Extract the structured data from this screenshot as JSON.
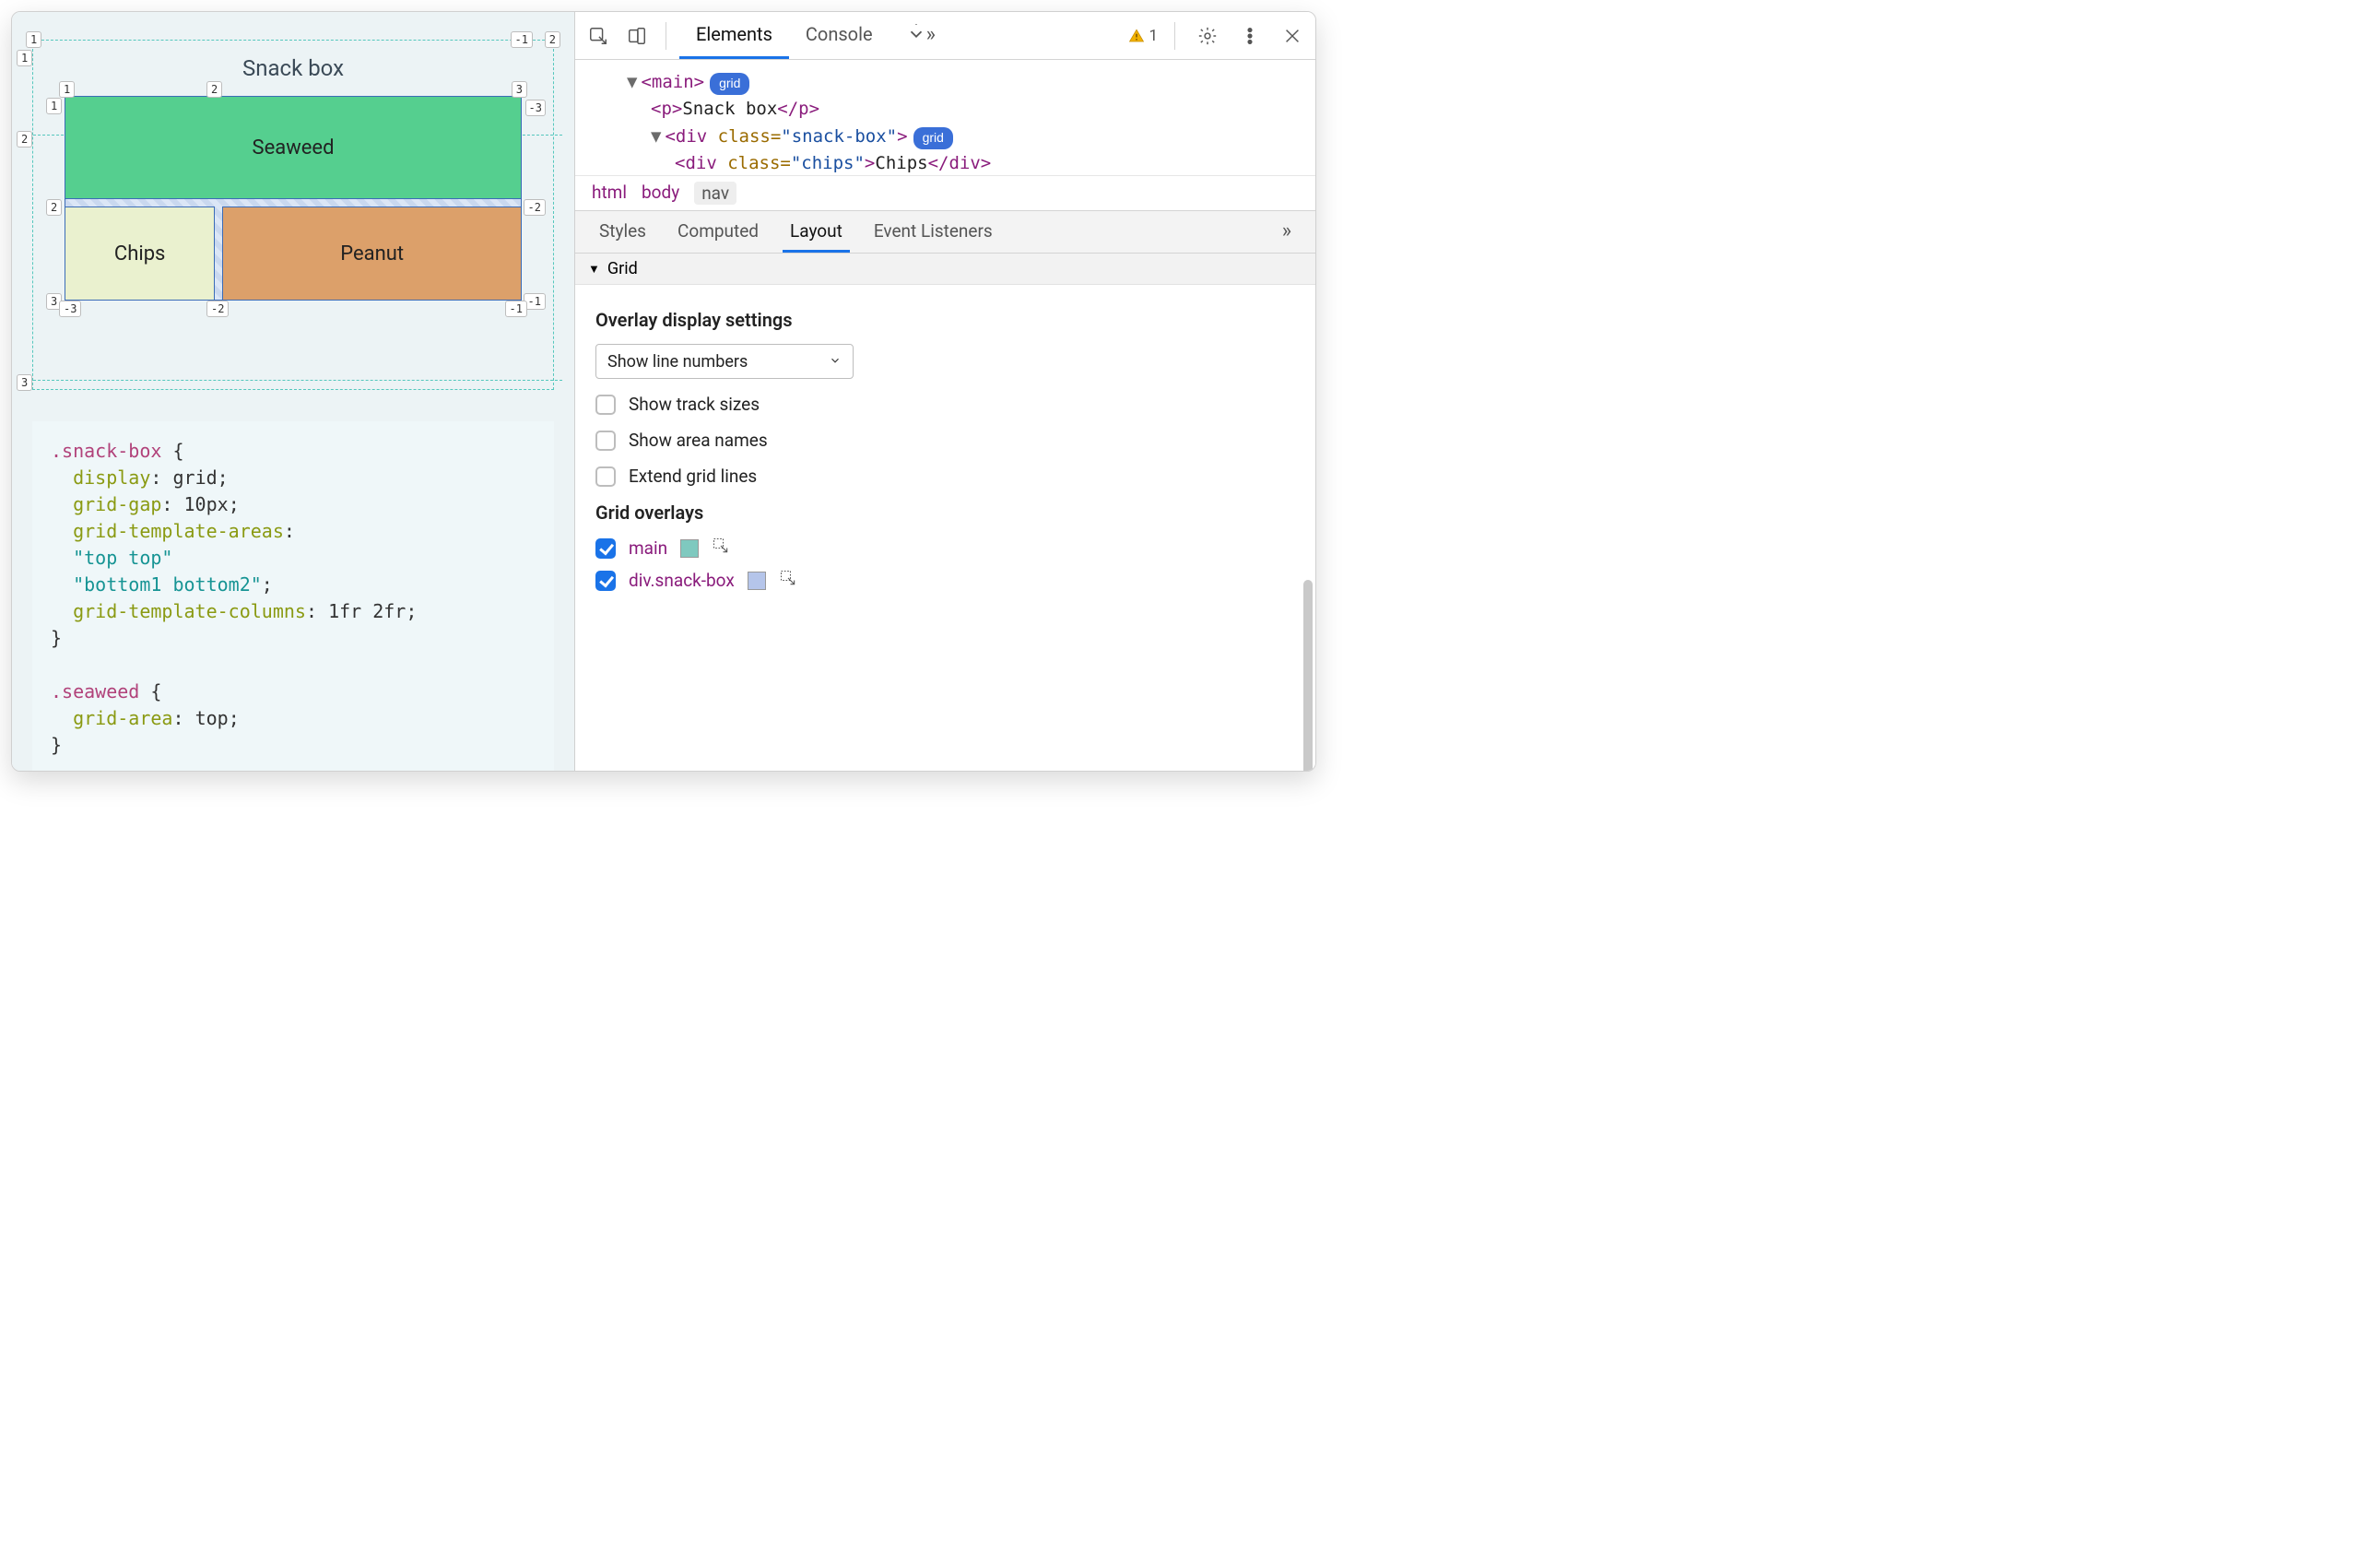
{
  "page": {
    "title": "Snack box",
    "cells": {
      "seaweed": "Seaweed",
      "chips": "Chips",
      "peanut": "Peanut"
    },
    "outer_lines": {
      "col": [
        "1",
        "-1",
        "2"
      ],
      "row_left": [
        "1",
        "2",
        "3"
      ]
    },
    "inner_lines": {
      "top": [
        "1",
        "2",
        "3"
      ],
      "top_neg": [
        "",
        "",
        "-3"
      ],
      "mid": [
        "2",
        "",
        "-2"
      ],
      "bot": [
        "3",
        "",
        "-1"
      ],
      "bot_neg": [
        "-3",
        "-2",
        "-1"
      ],
      "c_top_neg_left": "-3"
    }
  },
  "code": {
    "sel1": ".snack-box",
    "l1a": "display",
    "l1b": "grid",
    "l2a": "grid-gap",
    "l2b": "10px",
    "l3a": "grid-template-areas",
    "l3b": "\"top top\"",
    "l3c": "\"bottom1 bottom2\"",
    "l4a": "grid-template-columns",
    "l4b": "1fr 2fr",
    "sel2": ".seaweed",
    "l5a": "grid-area",
    "l5b": "top"
  },
  "devtools": {
    "tabs": {
      "elements": "Elements",
      "console": "Console"
    },
    "warning_count": "1",
    "dom": {
      "main_open": "<main>",
      "p_line": "<p>Snack box</p>",
      "div_open_a": "<div ",
      "div_open_b": "class=",
      "div_open_c": "\"snack-box\"",
      "div_open_d": ">",
      "chips_a": "<div ",
      "chips_b": "class=",
      "chips_c": "\"chips\"",
      "chips_d": ">Chips</div>",
      "grid_pill": "grid"
    },
    "breadcrumb": [
      "html",
      "body",
      "nav"
    ],
    "subtabs": {
      "styles": "Styles",
      "computed": "Computed",
      "layout": "Layout",
      "listeners": "Event Listeners"
    },
    "section": "Grid",
    "overlay_heading": "Overlay display settings",
    "select_value": "Show line numbers",
    "checks": {
      "track_sizes": "Show track sizes",
      "area_names": "Show area names",
      "extend_lines": "Extend grid lines"
    },
    "overlays_heading": "Grid overlays",
    "overlays": [
      {
        "label": "main",
        "color": "#7fc9bf"
      },
      {
        "label": "div.snack-box",
        "color": "#b5c5ea"
      }
    ]
  }
}
